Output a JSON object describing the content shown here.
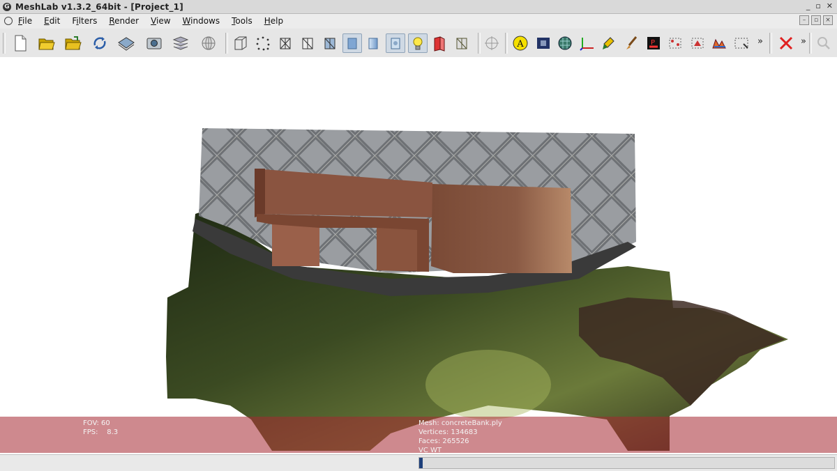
{
  "window": {
    "title": "MeshLab v1.3.2_64bit - [Project_1]",
    "app_icon": "meshlab-logo-icon",
    "controls": [
      "_",
      "▫",
      "✕"
    ]
  },
  "menubar": {
    "items": [
      {
        "label": "File",
        "key": "F"
      },
      {
        "label": "Edit",
        "key": "E"
      },
      {
        "label": "Filters",
        "key": "i"
      },
      {
        "label": "Render",
        "key": "R"
      },
      {
        "label": "View",
        "key": "V"
      },
      {
        "label": "Windows",
        "key": "W"
      },
      {
        "label": "Tools",
        "key": "T"
      },
      {
        "label": "Help",
        "key": "H"
      }
    ],
    "mdi_controls": [
      "–",
      "▫",
      "×"
    ]
  },
  "toolbar": {
    "overflow_1": "»",
    "overflow_2": "»",
    "icons": [
      "new-document-icon",
      "open-folder-icon",
      "open-project-icon",
      "reload-icon",
      "save-icon",
      "snapshot-icon",
      "layers-icon",
      "globe-icon",
      "bounding-box-icon",
      "points-icon",
      "wireframe-icon",
      "hidden-lines-icon",
      "flat-lines-icon",
      "flat-shading-icon",
      "smooth-shading-icon",
      "texture-icon",
      "light-icon",
      "double-side-lighting-icon",
      "back-face-culling-icon",
      "align-target-icon",
      "annotation-icon",
      "raster-icon",
      "color-picker-icon",
      "axes-icon",
      "paint-icon",
      "brush-icon",
      "measure-icon",
      "select-vertices-icon",
      "select-faces-icon",
      "quality-icon",
      "select-rect-icon",
      "delete-icon",
      "search-icon"
    ]
  },
  "viewport": {
    "fov_line": "FOV: 60",
    "fps_line": "FPS:    8.3",
    "mesh_line": "Mesh: concreteBank.ply",
    "vertices_line": "Vertices: 134683",
    "faces_line": "Faces: 265526",
    "vc_line": "VC WT",
    "info_color": "#a52832"
  },
  "statusbar": {
    "progress": 0.008
  }
}
